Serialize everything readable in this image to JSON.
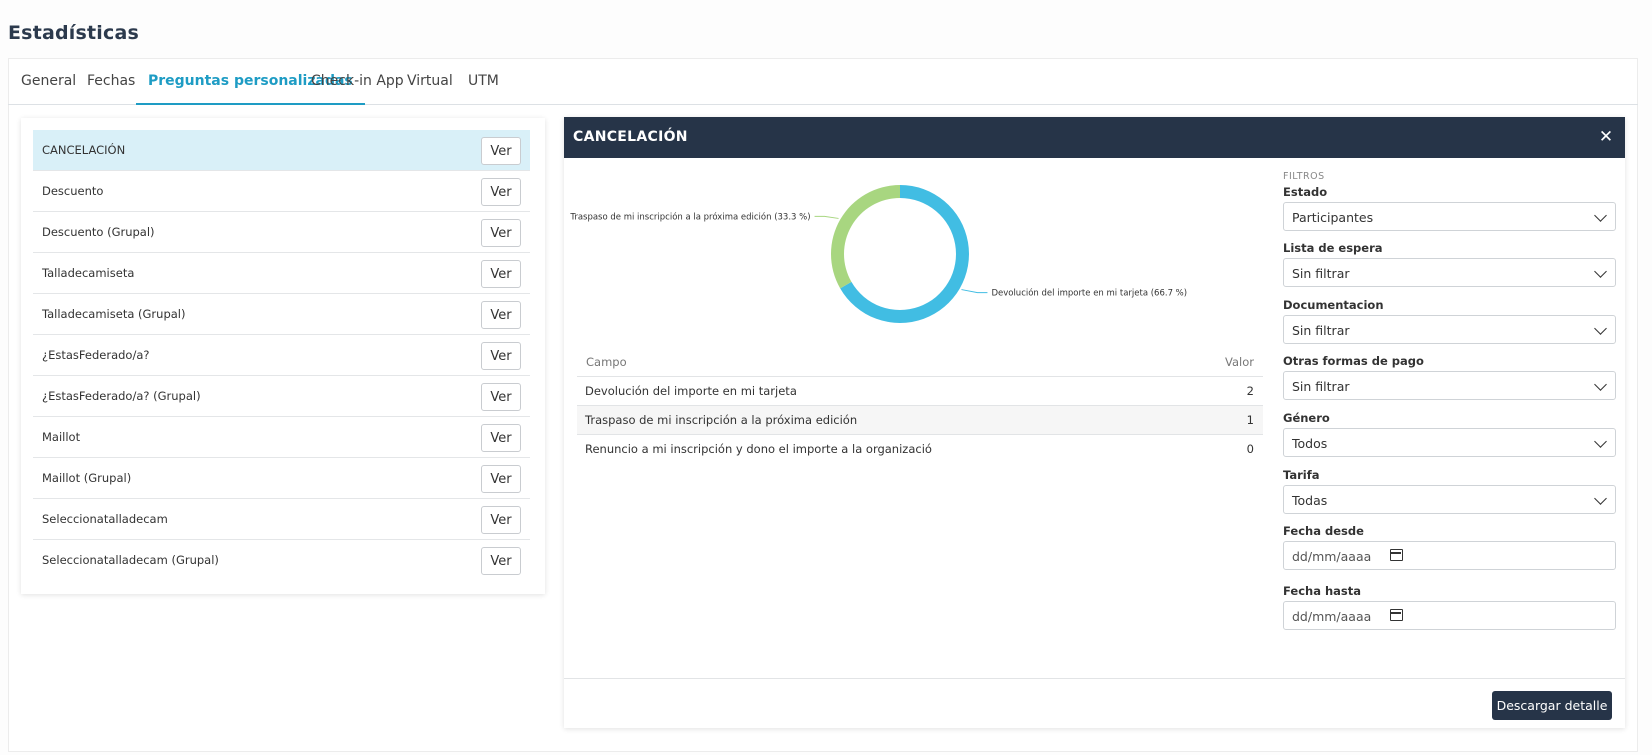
{
  "page": {
    "title": "Estadísticas"
  },
  "tabs": [
    {
      "label": "General"
    },
    {
      "label": "Fechas"
    },
    {
      "label": "Preguntas personalizadas",
      "active": true
    },
    {
      "label": "Check-in App"
    },
    {
      "label": "Virtual"
    },
    {
      "label": "UTM"
    }
  ],
  "questions": {
    "button_label": "Ver",
    "items": [
      {
        "label": "CANCELACIÓN",
        "selected": true
      },
      {
        "label": "Descuento"
      },
      {
        "label": "Descuento (Grupal)"
      },
      {
        "label": "Talladecamiseta"
      },
      {
        "label": "Talladecamiseta (Grupal)"
      },
      {
        "label": "¿EstasFederado/a?"
      },
      {
        "label": "¿EstasFederado/a? (Grupal)"
      },
      {
        "label": "Maillot"
      },
      {
        "label": "Maillot (Grupal)"
      },
      {
        "label": "Seleccionatalladecam"
      },
      {
        "label": "Seleccionatalladecam (Grupal)"
      }
    ]
  },
  "detail": {
    "title": "CANCELACIÓN",
    "close_glyph": "✕",
    "download_label": "Descargar detalle"
  },
  "chart_data": {
    "type": "pie",
    "donut": true,
    "slices": [
      {
        "label": "Devolución del importe en mi tarjeta (66.7 %)",
        "value": 66.7,
        "color": "#41bde3"
      },
      {
        "label": "Traspaso de mi inscripción a la próxima edición (33.3 %)",
        "value": 33.3,
        "color": "#a8d680"
      }
    ]
  },
  "table": {
    "headers": {
      "campo": "Campo",
      "valor": "Valor"
    },
    "rows": [
      {
        "campo": "Devolución del importe en mi tarjeta",
        "valor": "2"
      },
      {
        "campo": "Traspaso de mi inscripción a la próxima edición",
        "valor": "1"
      },
      {
        "campo": "Renuncio a mi inscripción y dono el importe a la organizació",
        "valor": "0"
      }
    ]
  },
  "filters": {
    "title": "FILTROS",
    "estado": {
      "label": "Estado",
      "value": "Participantes"
    },
    "lista_espera": {
      "label": "Lista de espera",
      "value": "Sin filtrar"
    },
    "documentacion": {
      "label": "Documentacion",
      "value": "Sin filtrar"
    },
    "otras_formas_pago": {
      "label": "Otras formas de pago",
      "value": "Sin filtrar"
    },
    "genero": {
      "label": "Género",
      "value": "Todos"
    },
    "tarifa": {
      "label": "Tarifa",
      "value": "Todas"
    },
    "fecha_desde": {
      "label": "Fecha desde",
      "placeholder": "dd/mm/aaaa"
    },
    "fecha_hasta": {
      "label": "Fecha hasta",
      "placeholder": "dd/mm/aaaa"
    }
  }
}
